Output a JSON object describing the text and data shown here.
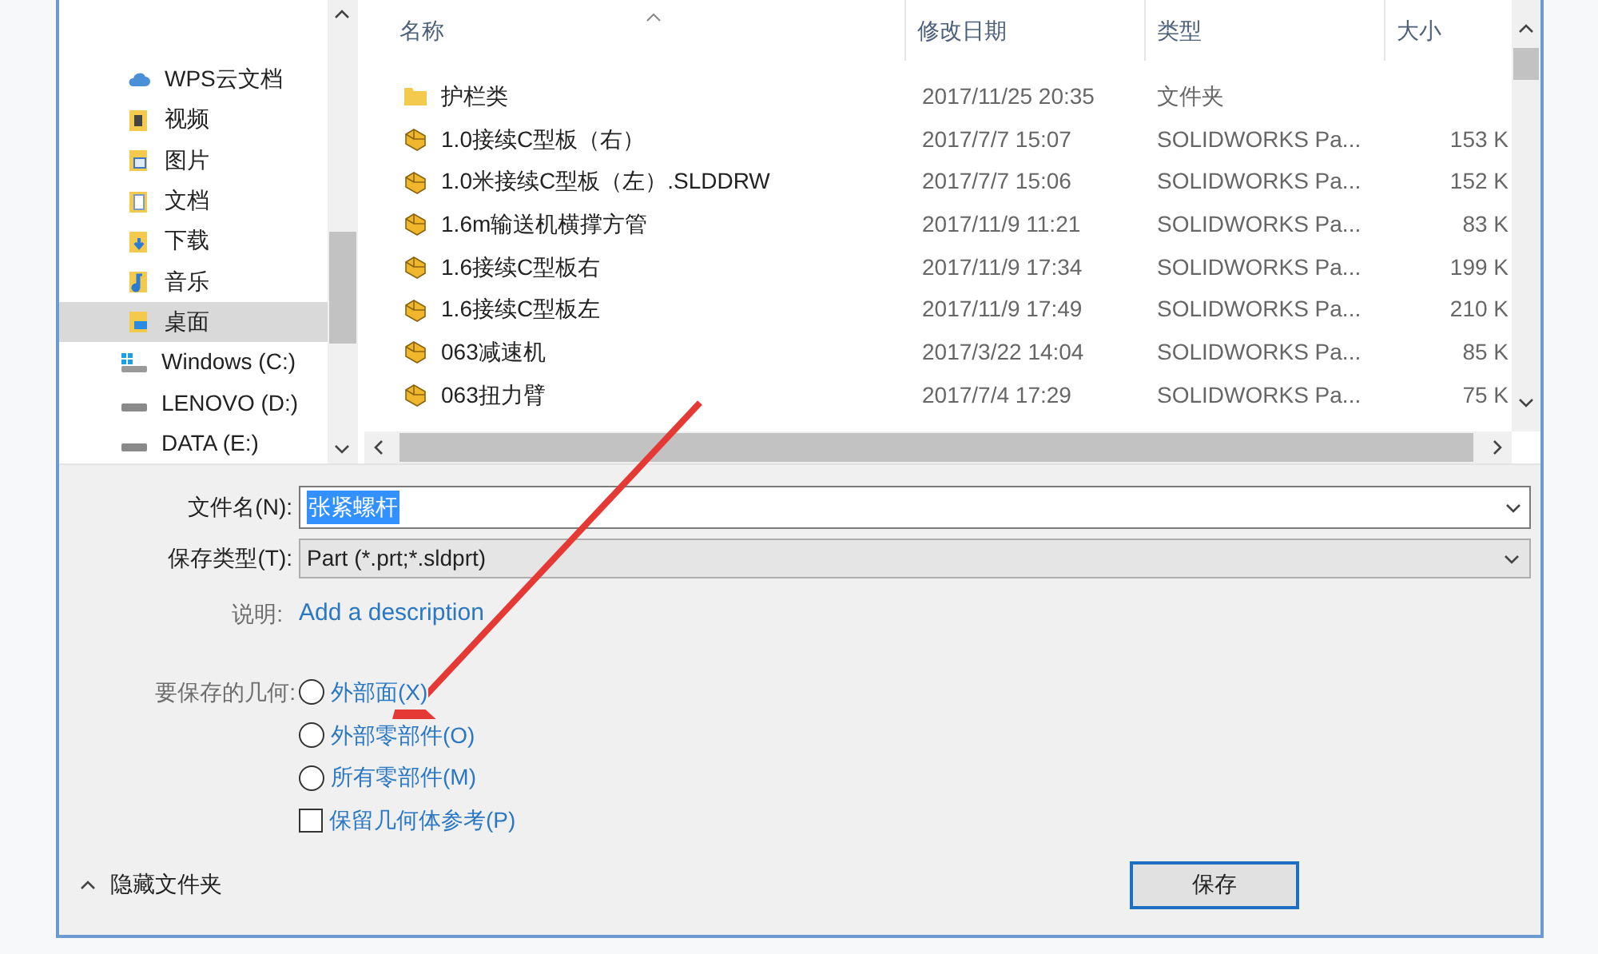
{
  "nav_pane": {
    "items": [
      {
        "label": "WPS云文档",
        "kind": "cloud",
        "selected": false
      },
      {
        "label": "视频",
        "kind": "video",
        "selected": false
      },
      {
        "label": "图片",
        "kind": "picture",
        "selected": false
      },
      {
        "label": "文档",
        "kind": "document",
        "selected": false
      },
      {
        "label": "下载",
        "kind": "download",
        "selected": false
      },
      {
        "label": "音乐",
        "kind": "music",
        "selected": false
      },
      {
        "label": "桌面",
        "kind": "desktop",
        "selected": true
      },
      {
        "label": "Windows (C:)",
        "kind": "system_drive",
        "selected": false
      },
      {
        "label": "LENOVO (D:)",
        "kind": "drive",
        "selected": false
      },
      {
        "label": "DATA (E:)",
        "kind": "drive",
        "selected": false
      }
    ]
  },
  "file_list": {
    "columns": [
      "名称",
      "修改日期",
      "类型",
      "大小"
    ],
    "rows": [
      {
        "kind": "folder",
        "name": "护栏类",
        "date": "2017/11/25 20:35",
        "type": "文件夹",
        "size": ""
      },
      {
        "kind": "part",
        "name": "1.0接续C型板（右）",
        "date": "2017/7/7 15:07",
        "type": "SOLIDWORKS Pa...",
        "size": "153 K"
      },
      {
        "kind": "part",
        "name": "1.0米接续C型板（左）.SLDDRW",
        "date": "2017/7/7 15:06",
        "type": "SOLIDWORKS Pa...",
        "size": "152 K"
      },
      {
        "kind": "part",
        "name": "1.6m输送机横撑方管",
        "date": "2017/11/9 11:21",
        "type": "SOLIDWORKS Pa...",
        "size": "83 K"
      },
      {
        "kind": "part",
        "name": "1.6接续C型板右",
        "date": "2017/11/9 17:34",
        "type": "SOLIDWORKS Pa...",
        "size": "199 K"
      },
      {
        "kind": "part",
        "name": "1.6接续C型板左",
        "date": "2017/11/9 17:49",
        "type": "SOLIDWORKS Pa...",
        "size": "210 K"
      },
      {
        "kind": "part",
        "name": "063减速机",
        "date": "2017/3/22 14:04",
        "type": "SOLIDWORKS Pa...",
        "size": "85 K"
      },
      {
        "kind": "part",
        "name": "063扭力臂",
        "date": "2017/7/4 17:29",
        "type": "SOLIDWORKS Pa...",
        "size": "75 K"
      }
    ]
  },
  "form": {
    "file_name": {
      "label": "文件名(N):",
      "value": "张紧螺杆"
    },
    "save_type": {
      "label": "保存类型(T):",
      "value": "Part (*.prt;*.sldprt)"
    },
    "description": {
      "label": "说明:",
      "link": "Add a description"
    },
    "geometry": {
      "label": "要保存的几何:",
      "options": [
        {
          "kind": "radio",
          "label": "外部面(X)",
          "checked": false
        },
        {
          "kind": "radio",
          "label": "外部零部件(O)",
          "checked": false
        },
        {
          "kind": "radio",
          "label": "所有零部件(M)",
          "checked": false
        },
        {
          "kind": "checkbox",
          "label": "保留几何体参考(P)",
          "checked": false
        }
      ]
    }
  },
  "hide_folders": "隐藏文件夹",
  "save_button": "保存"
}
